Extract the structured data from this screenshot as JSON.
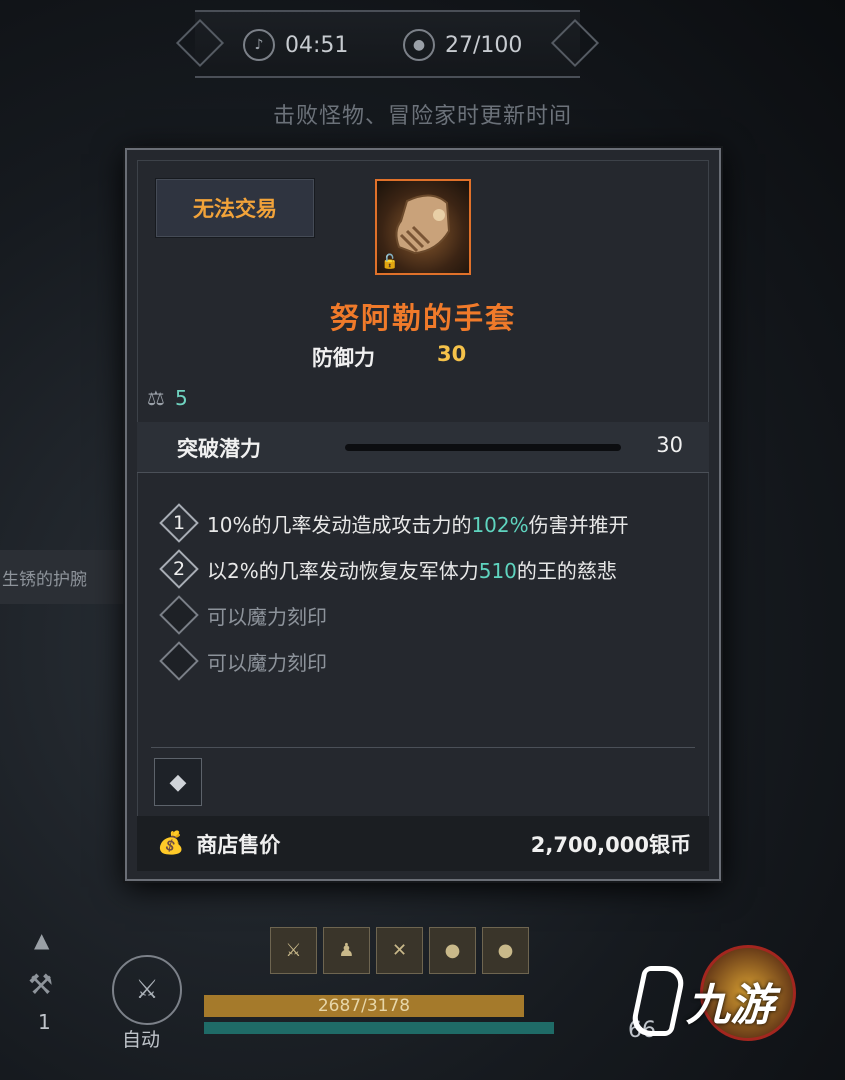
{
  "hud": {
    "timer": "04:51",
    "players": "27/100",
    "hint": "击败怪物、冒险家时更新时间",
    "icons": [
      "music-note-icon",
      "person-icon"
    ]
  },
  "background": {
    "side_item": "生锈的护腕"
  },
  "tooltip": {
    "trade_status": "无法交易",
    "item_icon": "gauntlet-icon",
    "item_name": "努阿勒的手套",
    "rarity_color": "#f07a2a",
    "stat_label": "防御力",
    "stat_value": "30",
    "weight_icon": "weight-icon",
    "weight_value": "5",
    "potential_label": "突破潜力",
    "potential_value": "30",
    "abilities": [
      {
        "index": "1",
        "prefix": "10%的几率发动造成攻击力的",
        "highlight": "102%",
        "suffix": "伤害并推开"
      },
      {
        "index": "2",
        "prefix": "以2%的几率发动恢复友军体力",
        "highlight": "510",
        "suffix": "的王的慈悲"
      },
      {
        "text": "可以魔力刻印"
      },
      {
        "text": "可以魔力刻印"
      }
    ],
    "gem_slot_icon": "gem-plus-icon",
    "price_icon": "money-bag-icon",
    "price_label": "商店售价",
    "price_value": "2,700,000银币"
  },
  "bottom_hud": {
    "hp_text": "2687/3178",
    "auto_label": "自动",
    "left_count": "1",
    "right_count": "66",
    "skill_icons": [
      "skill-1-icon",
      "skill-2-icon",
      "skill-3-icon",
      "skill-4-icon",
      "skill-5-icon"
    ]
  },
  "watermark": {
    "text": "九游"
  }
}
